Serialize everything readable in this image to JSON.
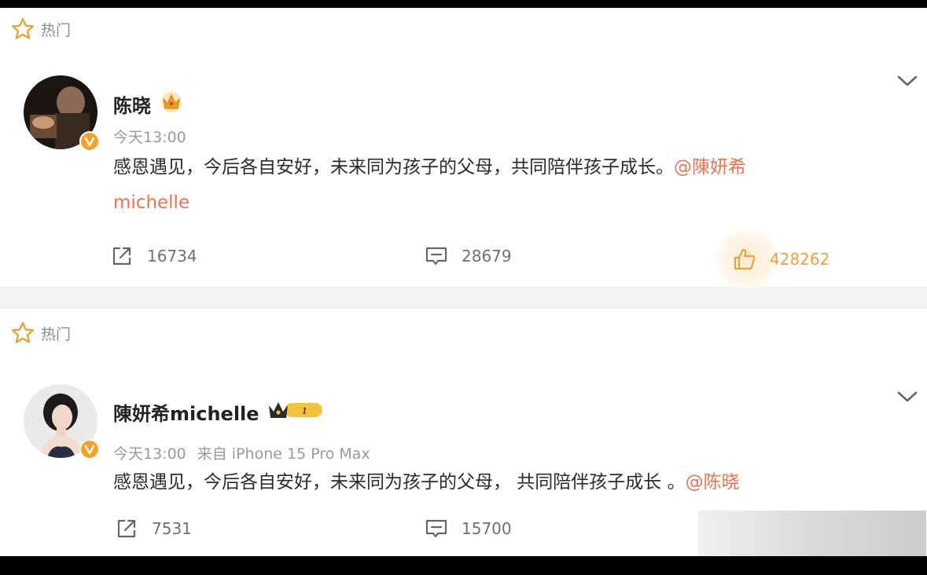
{
  "posts": [
    {
      "hot_label": "热门",
      "username": "陈晓",
      "time": "今天13:00",
      "source": "",
      "content_text": "感恩遇见，今后各自安好，未来同为孩子的父母，共同陪伴孩子成长。",
      "mention_line1": "@陳妍希",
      "mention_line2": "michelle",
      "repost_count": "16734",
      "comment_count": "28679",
      "like_count": "428262"
    },
    {
      "hot_label": "热门",
      "username": "陳妍希michelle",
      "time": "今天13:00",
      "source": "来自 iPhone 15 Pro Max",
      "content_text": "感恩遇见，今后各自安好，未来同为孩子的父母， 共同陪伴孩子成长 。",
      "mention": "@陈晓",
      "repost_count": "7531",
      "comment_count": "15700",
      "badge_level": "1"
    }
  ],
  "colors": {
    "accent": "#eb7350",
    "like_active": "#e8a23a",
    "verified_badge": "#f7a128"
  },
  "icons": [
    "star-outline-icon",
    "verified-badge-icon",
    "crown-badge-icon",
    "repost-icon",
    "comment-icon",
    "thumbs-up-icon",
    "chevron-down-icon"
  ]
}
